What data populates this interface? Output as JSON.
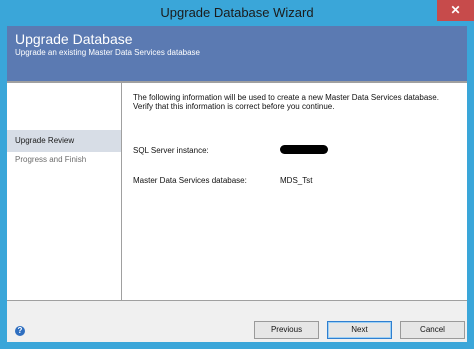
{
  "window": {
    "title": "Upgrade Database Wizard"
  },
  "header": {
    "title": "Upgrade Database",
    "subtitle": "Upgrade an existing Master Data Services database"
  },
  "nav": {
    "items": [
      {
        "label": "Upgrade Review",
        "selected": true
      },
      {
        "label": "Progress and Finish",
        "selected": false
      }
    ]
  },
  "main": {
    "intro_line1": "The following information will be used to create a new Master Data Services database.",
    "intro_line2": "Verify that this information is correct before you continue.",
    "sql_label": "SQL Server instance:",
    "sql_value_redacted": true,
    "db_label": "Master Data Services database:",
    "db_value": "MDS_Tst"
  },
  "footer": {
    "help_icon": "help-icon",
    "previous_label": "Previous",
    "next_label": "Next",
    "cancel_label": "Cancel"
  },
  "colors": {
    "titlebar": "#3aa6d9",
    "header": "#5b7ab2",
    "nav_selected": "#d7dde6",
    "close": "#c74b4b"
  }
}
